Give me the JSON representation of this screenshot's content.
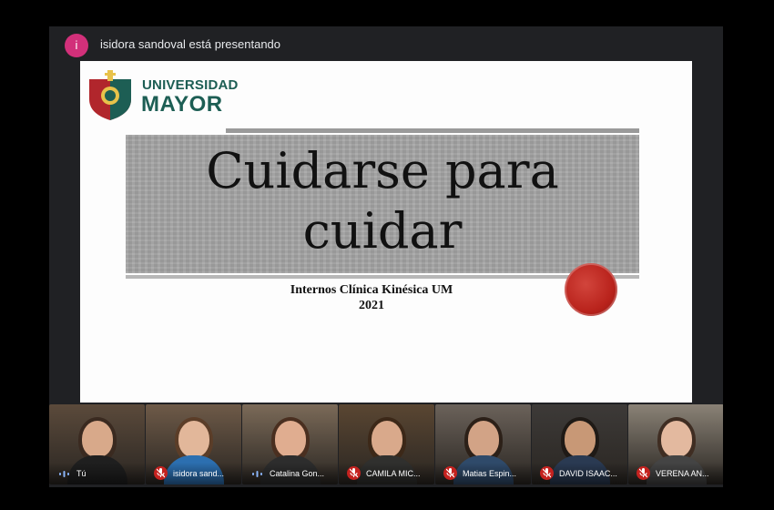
{
  "presenter": {
    "initial": "i",
    "text": "isidora sandoval está presentando"
  },
  "slide": {
    "logo_line1": "UNIVERSIDAD",
    "logo_line2": "MAYOR",
    "title_line1": "Cuidarse para",
    "title_line2": "cuidar",
    "subtitle_line1": "Internos Clínica Kinésica UM",
    "subtitle_line2": "2021"
  },
  "participants": [
    {
      "name": "Tú",
      "status": "speaking",
      "bg": "#5b4a3b",
      "skin": "#d8a98a",
      "hair": "#3a2a20",
      "shirt": "#1f1f1f"
    },
    {
      "name": "isidora sand...",
      "status": "muted",
      "bg": "#6e5a48",
      "skin": "#e2b79a",
      "hair": "#5b3d28",
      "shirt": "#2c6fb0"
    },
    {
      "name": "Catalina Gon...",
      "status": "speaking",
      "bg": "#7b6a58",
      "skin": "#e0ad90",
      "hair": "#4a2f20",
      "shirt": "#2d2d2d"
    },
    {
      "name": "CAMILA MIC...",
      "status": "muted",
      "bg": "#5a4632",
      "skin": "#d9a98b",
      "hair": "#3c2818",
      "shirt": "#30302e"
    },
    {
      "name": "Matias Espin...",
      "status": "muted",
      "bg": "#6b625a",
      "skin": "#d2a386",
      "hair": "#2c2018",
      "shirt": "#2f4a6a"
    },
    {
      "name": "DAVID ISAAC...",
      "status": "muted",
      "bg": "#3d3a38",
      "skin": "#c89876",
      "hair": "#1f1a16",
      "shirt": "#2a3a52"
    },
    {
      "name": "VERENA AN...",
      "status": "muted",
      "bg": "#8a8276",
      "skin": "#e3b99f",
      "hair": "#3f2d22",
      "shirt": "#444"
    }
  ],
  "colors": {
    "app_bg": "#202124",
    "avatar_pink": "#d2307a",
    "logo_green": "#1d5e54",
    "logo_red": "#b1262c",
    "mute_red": "#c5221f",
    "speak_teal": "#8ab4f8"
  }
}
